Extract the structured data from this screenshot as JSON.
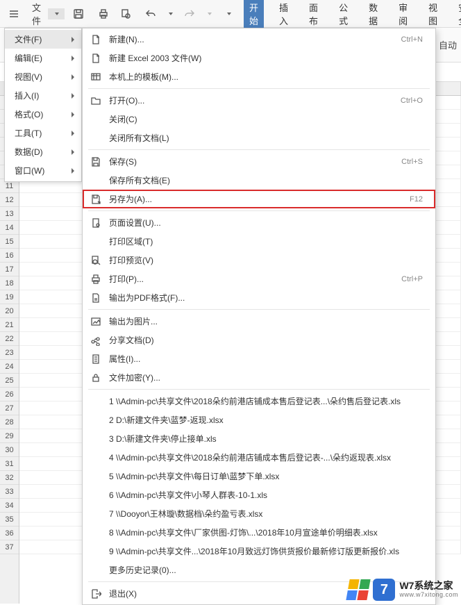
{
  "toolbar": {
    "file_label": "文件",
    "ribbon_tabs": [
      "开始",
      "插入",
      "页面布局",
      "公式",
      "数据",
      "审阅",
      "视图",
      "安全"
    ],
    "active_tab_index": 0
  },
  "ribbon_row2": {
    "auto_label": "自动"
  },
  "file_submenu": [
    {
      "label": "文件(F)",
      "hover": true
    },
    {
      "label": "编辑(E)"
    },
    {
      "label": "视图(V)"
    },
    {
      "label": "插入(I)"
    },
    {
      "label": "格式(O)"
    },
    {
      "label": "工具(T)"
    },
    {
      "label": "数据(D)"
    },
    {
      "label": "窗口(W)"
    }
  ],
  "file_menu": [
    {
      "icon": "new",
      "label": "新建(N)...",
      "shortcut": "Ctrl+N"
    },
    {
      "icon": "new",
      "label": "新建 Excel 2003 文件(W)"
    },
    {
      "icon": "template",
      "label": "本机上的模板(M)..."
    },
    {
      "sep": true
    },
    {
      "icon": "open",
      "label": "打开(O)...",
      "shortcut": "Ctrl+O"
    },
    {
      "icon": "",
      "label": "关闭(C)"
    },
    {
      "icon": "",
      "label": "关闭所有文档(L)"
    },
    {
      "sep": true
    },
    {
      "icon": "save",
      "label": "保存(S)",
      "shortcut": "Ctrl+S"
    },
    {
      "icon": "",
      "label": "保存所有文档(E)"
    },
    {
      "icon": "saveas",
      "label": "另存为(A)...",
      "shortcut": "F12",
      "highlight": true
    },
    {
      "sep": true
    },
    {
      "icon": "pagesetup",
      "label": "页面设置(U)..."
    },
    {
      "icon": "",
      "label": "打印区域(T)"
    },
    {
      "icon": "preview",
      "label": "打印预览(V)"
    },
    {
      "icon": "print",
      "label": "打印(P)...",
      "shortcut": "Ctrl+P"
    },
    {
      "icon": "pdf",
      "label": "输出为PDF格式(F)..."
    },
    {
      "sep": true
    },
    {
      "icon": "image",
      "label": "输出为图片..."
    },
    {
      "icon": "share",
      "label": "分享文档(D)"
    },
    {
      "icon": "props",
      "label": "属性(I)..."
    },
    {
      "icon": "lock",
      "label": "文件加密(Y)..."
    },
    {
      "sep": true
    },
    {
      "icon": "",
      "label": "1 \\\\Admin-pc\\共享文件\\2018朵约前港店铺成本售后登记表...\\朵约售后登记表.xls"
    },
    {
      "icon": "",
      "label": "2 D:\\新建文件夹\\蓝梦-返现.xlsx"
    },
    {
      "icon": "",
      "label": "3 D:\\新建文件夹\\停止接单.xls"
    },
    {
      "icon": "",
      "label": "4 \\\\Admin-pc\\共享文件\\2018朵约前港店铺成本售后登记表-...\\朵约返现表.xlsx"
    },
    {
      "icon": "",
      "label": "5 \\\\Admin-pc\\共享文件\\每日订单\\蓝梦下单.xlsx"
    },
    {
      "icon": "",
      "label": "6 \\\\Admin-pc\\共享文件\\小琴人群表-10-1.xls"
    },
    {
      "icon": "",
      "label": "7 \\\\Dooyor\\王林璇\\数据档\\朵约盈亏表.xlsx"
    },
    {
      "icon": "",
      "label": "8 \\\\Admin-pc\\共享文件\\厂家供图-灯饰\\...\\2018年10月宣途单价明细表.xlsx"
    },
    {
      "icon": "",
      "label": "9 \\\\Admin-pc\\共享文件...\\2018年10月致远灯饰供货报价最新修订版更新报价.xls"
    },
    {
      "icon": "",
      "label": "更多历史记录(0)..."
    },
    {
      "sep": true
    },
    {
      "icon": "exit",
      "label": "退出(X)"
    }
  ],
  "grid": {
    "rows_start": 5,
    "rows_end": 37,
    "cols": [
      "",
      "",
      "",
      "",
      "",
      "",
      "",
      "",
      ""
    ]
  },
  "watermark": {
    "big7": "7",
    "title": "W7系统之家",
    "sub": "www.w7xitong.com"
  }
}
